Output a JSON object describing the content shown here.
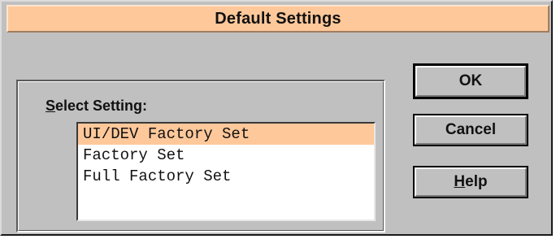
{
  "dialog": {
    "title": "Default Settings"
  },
  "select_setting": {
    "label_mnemonic": "S",
    "label_rest": "elect Setting:",
    "options": [
      "UI/DEV Factory Set",
      "Factory Set",
      "Full Factory Set"
    ],
    "selected_index": 0
  },
  "buttons": {
    "ok_label": "OK",
    "cancel_label": "Cancel",
    "help_mnemonic": "H",
    "help_rest": "elp"
  },
  "colors": {
    "accent": "#ffc89a",
    "face": "#c0c0c0"
  }
}
